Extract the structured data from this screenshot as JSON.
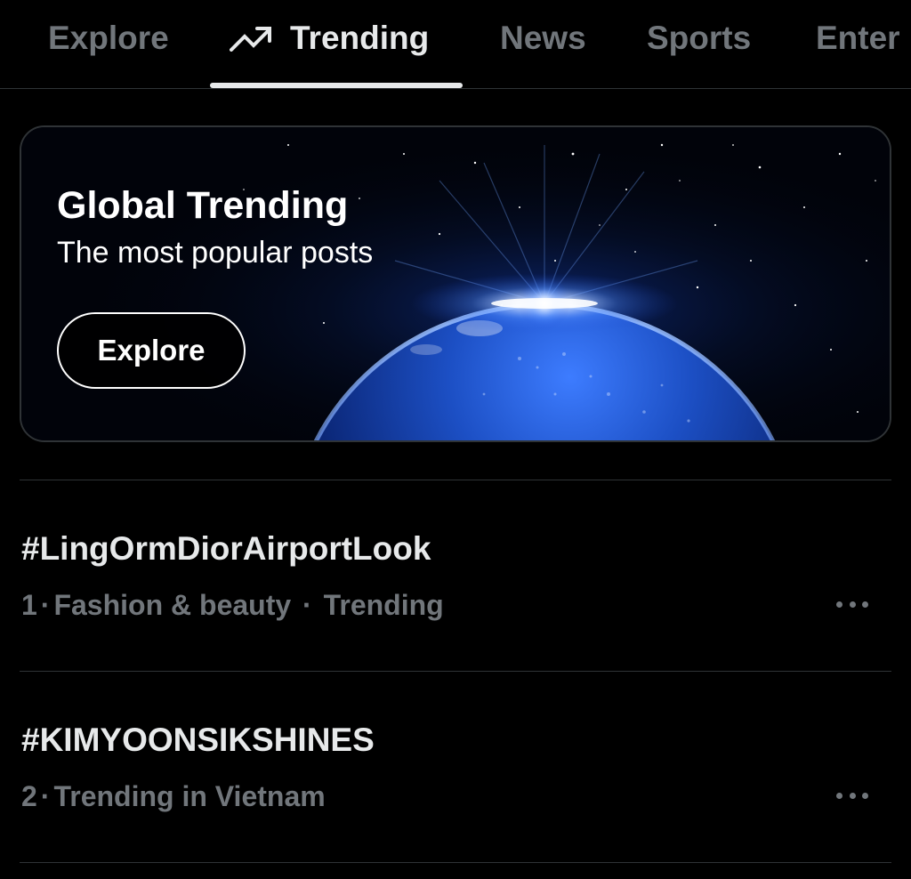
{
  "tabs": [
    {
      "label": "Explore",
      "active": false
    },
    {
      "label": "Trending",
      "active": true,
      "icon": "trending-up-icon"
    },
    {
      "label": "News",
      "active": false
    },
    {
      "label": "Sports",
      "active": false
    },
    {
      "label": "Enter",
      "active": false
    }
  ],
  "banner": {
    "title": "Global Trending",
    "subtitle": "The most popular posts",
    "button_label": "Explore"
  },
  "trends": [
    {
      "name": "#LingOrmDiorAirportLook",
      "rank": "1",
      "category": "Fashion & beauty",
      "context": "Trending"
    },
    {
      "name": "#KIMYOONSIKSHINES",
      "rank": "2",
      "category": "Trending in Vietnam"
    }
  ],
  "colors": {
    "background": "#000000",
    "text_primary": "#e7e9ea",
    "text_secondary": "#71767b",
    "divider": "#2f3336",
    "earth_glow": "#2f7bff"
  }
}
